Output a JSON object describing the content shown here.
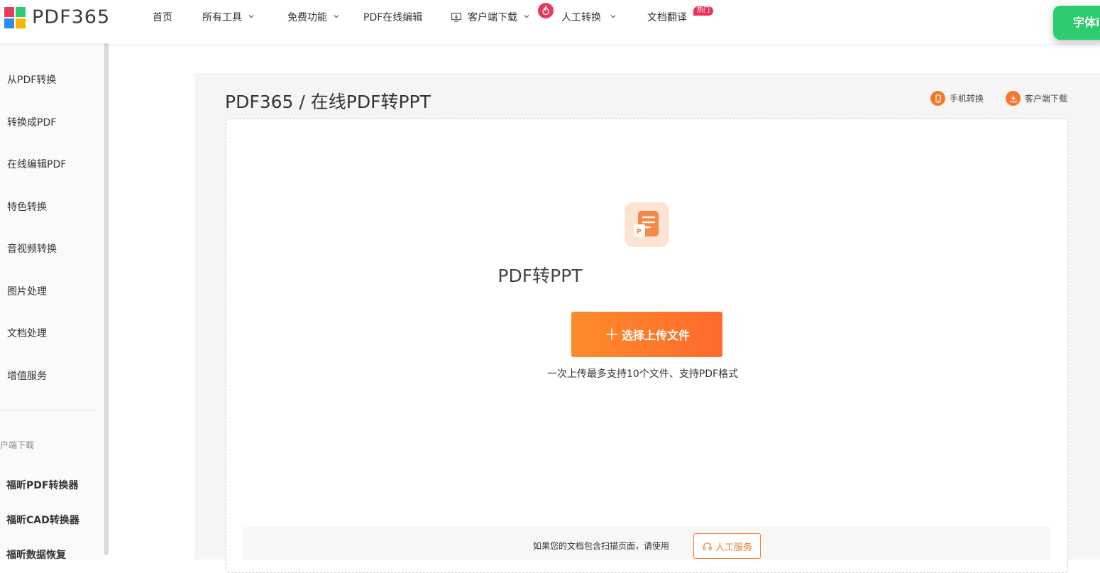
{
  "brand": {
    "name": "PDF365",
    "logo_colors": [
      "#ea3a5c",
      "#2ecc71",
      "#2d8cf0",
      "#f7b500"
    ]
  },
  "nav": {
    "items": [
      {
        "label": "首页"
      },
      {
        "label": "所有工具"
      },
      {
        "label": "免费功能"
      },
      {
        "label": "PDF在线编辑"
      },
      {
        "label": "客户端下载"
      },
      {
        "label": "人工转换"
      },
      {
        "label": "文档翻译"
      }
    ],
    "hot_badge": "热门",
    "cta_label": "字体i"
  },
  "sidebar": {
    "items": [
      {
        "label": "从PDF转换"
      },
      {
        "label": "转换成PDF"
      },
      {
        "label": "在线编辑PDF"
      },
      {
        "label": "特色转换"
      },
      {
        "label": "音视频转换"
      },
      {
        "label": "图片处理"
      },
      {
        "label": "文档处理"
      },
      {
        "label": "增值服务"
      }
    ],
    "section_title": "户端下载",
    "downloads": [
      {
        "label": "福昕PDF转换器"
      },
      {
        "label": "福昕CAD转换器"
      },
      {
        "label": "福昕数据恢复"
      }
    ]
  },
  "main": {
    "breadcrumb": "PDF365 / 在线PDF转PPT",
    "mobile_link": "手机转换",
    "client_link": "客户端下载",
    "tool_title": "PDF转PPT",
    "upload_label": "选择上传文件",
    "upload_hint": "一次上传最多支持10个文件、支持PDF格式",
    "notice_text": "如果您的文档包含扫描页面，请使用",
    "service_label": "人工服务"
  },
  "colors": {
    "accent": "#f5772e",
    "badge_red": "#ee3158",
    "cta_green": "#2ecc71"
  }
}
